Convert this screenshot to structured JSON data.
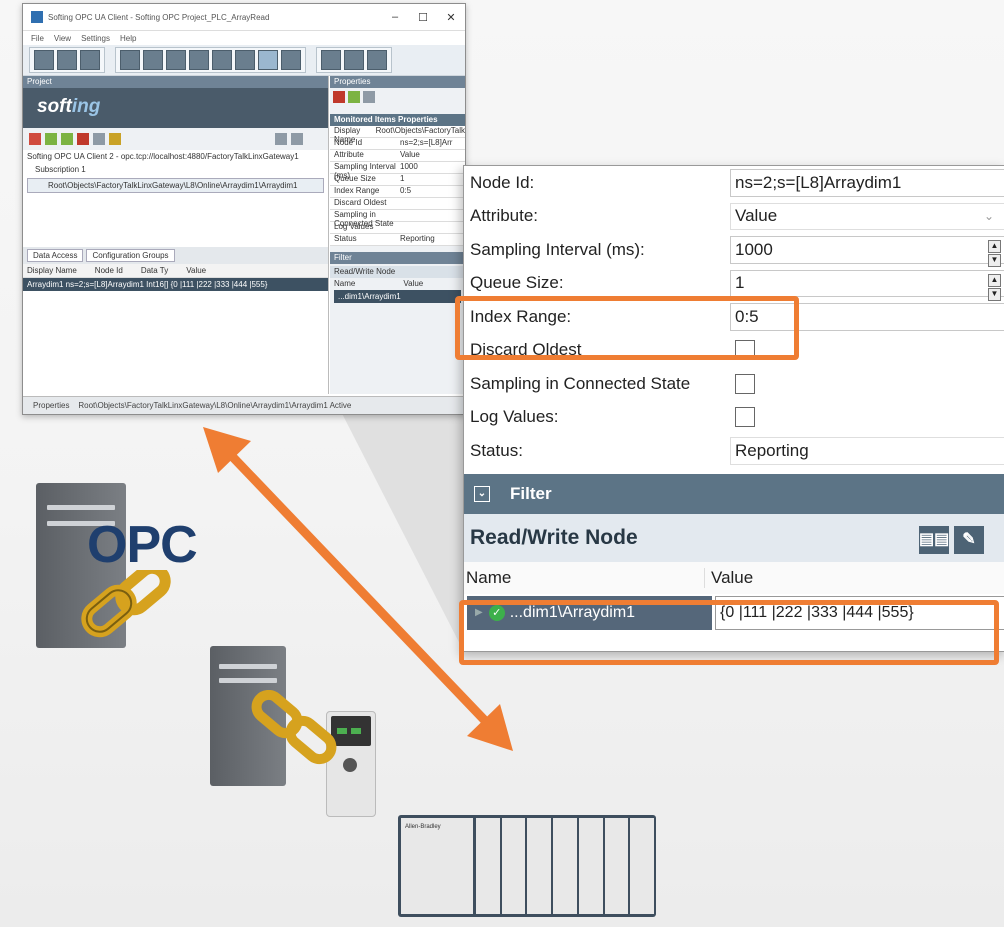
{
  "window": {
    "title": "Softing OPC UA Client - Softing OPC Project_PLC_ArrayRead",
    "controls": [
      "–",
      "☐",
      "✕"
    ],
    "menu": [
      "File",
      "View",
      "Settings",
      "Help"
    ],
    "project_pane_title": "Project",
    "properties_pane_title": "Properties",
    "brand": {
      "a": "soft",
      "b": "ing"
    },
    "tree_root": "Softing OPC UA Client 2 - opc.tcp://localhost:4880/FactoryTalkLinxGateway1",
    "tree_sub": "Subscription 1",
    "tree_item": "Root\\Objects\\FactoryTalkLinxGateway\\L8\\Online\\Arraydim1\\Arraydim1",
    "tabs": [
      "Data Access",
      "Configuration Groups"
    ],
    "grid_headers": [
      "Display Name",
      "Node Id",
      "Data Ty",
      "Value"
    ],
    "grid_row": "Arraydim1   ns=2;s=[L8]Arraydim1   Int16[]   {0 |111 |222 |333 |444 |555}",
    "mini_section": "Monitored Items Properties",
    "mini_rows": [
      [
        "Display Name",
        "Root\\Objects\\FactoryTalk"
      ],
      [
        "Node Id",
        "ns=2;s=[L8]Arr"
      ],
      [
        "Attribute",
        "Value"
      ],
      [
        "Sampling Interval (ms)",
        "1000"
      ],
      [
        "Queue Size",
        "1"
      ],
      [
        "Index Range",
        "0:5"
      ],
      [
        "Discard Oldest",
        ""
      ],
      [
        "Sampling in Connected State",
        ""
      ],
      [
        "Log Values",
        ""
      ],
      [
        "Status",
        "Reporting"
      ]
    ],
    "mini_filter": "Filter",
    "mini_rw": "Read/Write Node",
    "mini_cols": [
      "Name",
      "Value"
    ],
    "mini_rw_row": "...dim1\\Arraydim1",
    "status_left": "Properties",
    "status_path": "Root\\Objects\\FactoryTalkLinxGateway\\L8\\Online\\Arraydim1\\Arraydim1 Active"
  },
  "panel": {
    "rows": [
      {
        "label": "Node Id:",
        "value": "ns=2;s=[L8]Arraydim1"
      },
      {
        "label": "Attribute:",
        "value": "Value"
      },
      {
        "label": "Sampling Interval (ms):",
        "value": "1000"
      },
      {
        "label": "Queue Size:",
        "value": "1"
      },
      {
        "label": "Index Range:",
        "value": "0:5"
      },
      {
        "label": "Discard Oldest",
        "checked": false
      },
      {
        "label": "Sampling in Connected State",
        "checked": false
      },
      {
        "label": "Log Values:",
        "checked": false
      },
      {
        "label": "Status:",
        "value": "Reporting"
      }
    ],
    "filter_label": "Filter",
    "rw_title": "Read/Write Node",
    "col_name": "Name",
    "col_value": "Value",
    "node_name": "...dim1\\Arraydim1",
    "node_value": "{0 |111 |222 |333 |444 |555}"
  },
  "illustration": {
    "opc_text": "OPC",
    "plc_brand": "Allen-Bradley"
  },
  "colors": {
    "highlight": "#ef7d33",
    "arrow": "#ef7d33",
    "header_dark": "#5c7486",
    "opc_blue": "#1f3f6e",
    "chain_gold": "#d6a21e"
  }
}
